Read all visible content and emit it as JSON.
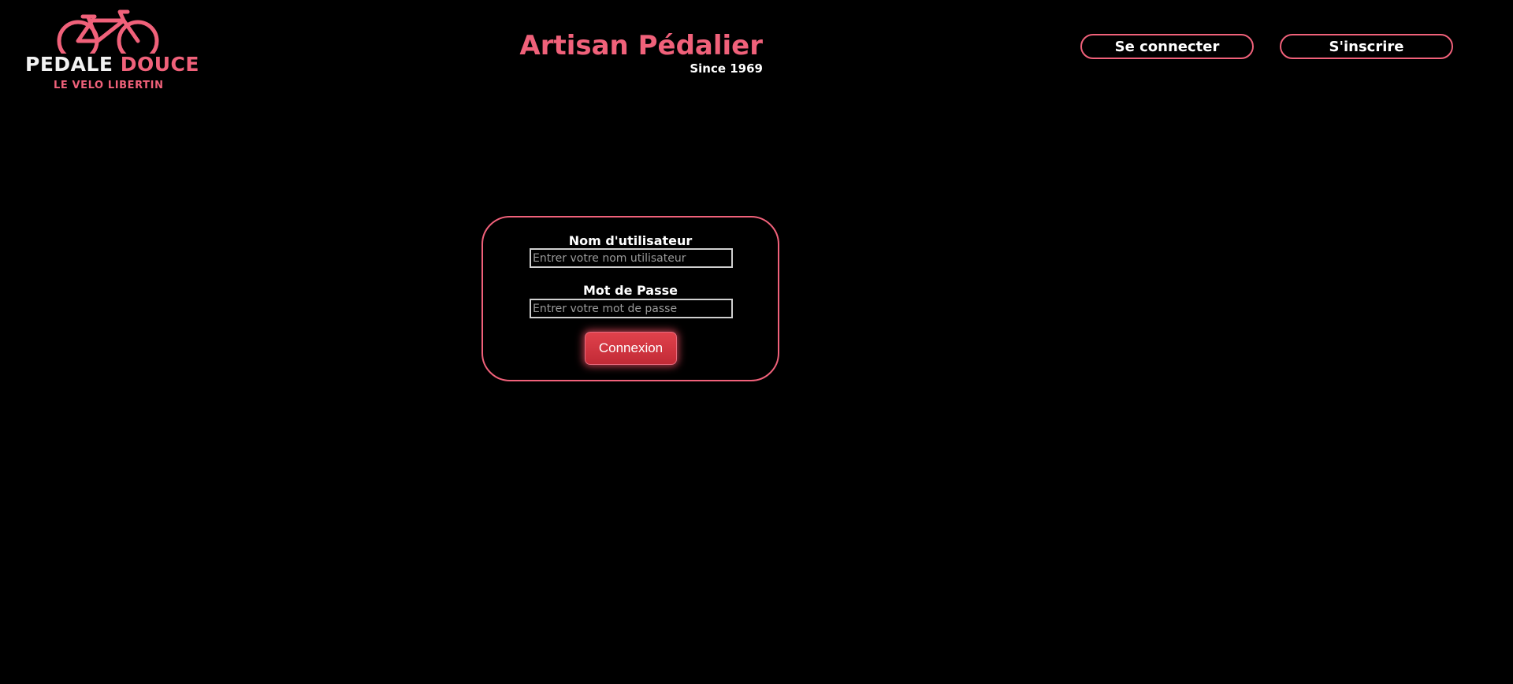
{
  "brand": {
    "logo_word_1": "PEDALE",
    "logo_word_2": "DOUCE",
    "logo_tagline": "LE VELO LIBERTIN",
    "logo_icon": "bicycle-icon",
    "accent_color": "#f0617a"
  },
  "header": {
    "title": "Artisan Pédalier",
    "subtitle": "Since 1969",
    "login_label": "Se connecter",
    "register_label": "S'inscrire"
  },
  "login_form": {
    "username_label": "Nom d'utilisateur",
    "username_placeholder": "Entrer votre nom utilisateur",
    "username_value": "",
    "password_label": "Mot de Passe",
    "password_placeholder": "Entrer votre mot de passe",
    "password_value": "",
    "submit_label": "Connexion",
    "submit_color": "#d63440"
  }
}
